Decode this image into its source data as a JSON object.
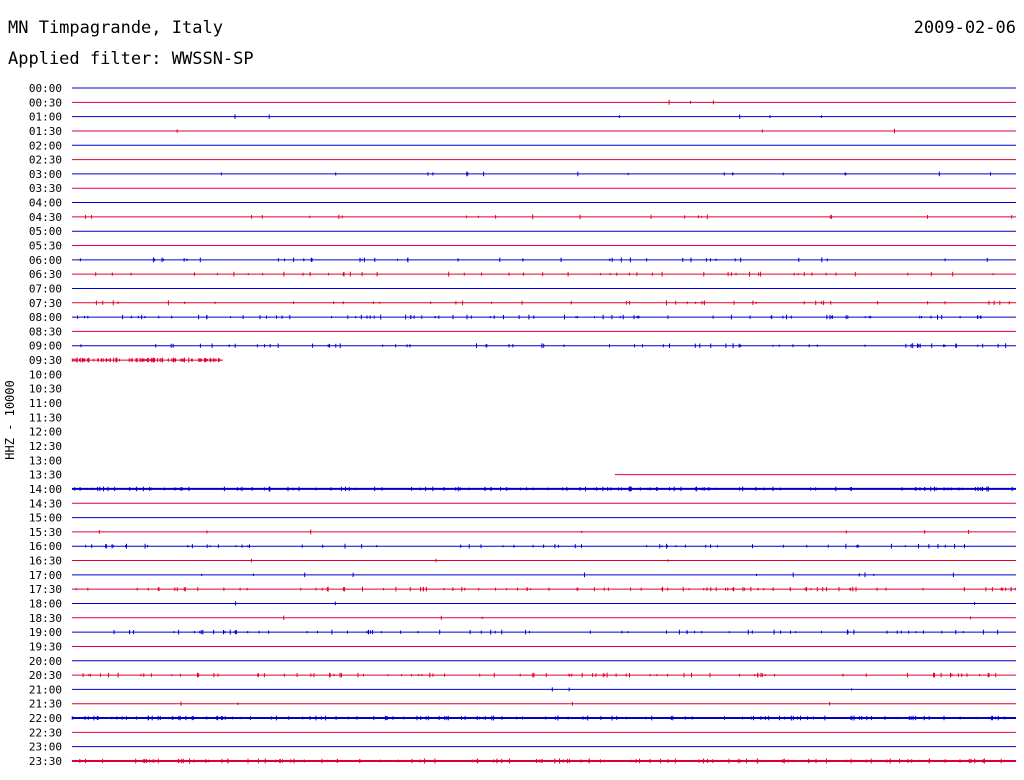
{
  "header": {
    "title": "MN Timpagrande, Italy",
    "date": "2009-02-06",
    "filter": "Applied filter: WWSSN-SP"
  },
  "colors": {
    "blue": "#0000cc",
    "red": "#dd0033",
    "background": "#ffffff",
    "text": "#000000"
  },
  "chart_data": {
    "type": "line",
    "title": "MN Timpagrande, Italy",
    "subtitle": "Applied filter: WWSSN-SP",
    "ylabel": "HHZ - 10000",
    "xlabel": "",
    "grid": false,
    "x_range_minutes": [
      0,
      30
    ],
    "series_colors": [
      "#0000cc",
      "#dd0033"
    ],
    "rows": [
      {
        "label": "00:00",
        "coverage": [
          0,
          1
        ],
        "activity": 0.0
      },
      {
        "label": "00:30",
        "coverage": [
          0,
          1
        ],
        "activity": 0.02
      },
      {
        "label": "01:00",
        "coverage": [
          0,
          1
        ],
        "activity": 0.04
      },
      {
        "label": "01:30",
        "coverage": [
          0,
          1
        ],
        "activity": 0.02
      },
      {
        "label": "02:00",
        "coverage": [
          0,
          1
        ],
        "activity": 0.0
      },
      {
        "label": "02:30",
        "coverage": [
          0,
          1
        ],
        "activity": 0.0
      },
      {
        "label": "03:00",
        "coverage": [
          0,
          1
        ],
        "activity": 0.12
      },
      {
        "label": "03:30",
        "coverage": [
          0,
          1
        ],
        "activity": 0.0
      },
      {
        "label": "04:00",
        "coverage": [
          0,
          1
        ],
        "activity": 0.0
      },
      {
        "label": "04:30",
        "coverage": [
          0,
          1
        ],
        "activity": 0.15
      },
      {
        "label": "05:00",
        "coverage": [
          0,
          1
        ],
        "activity": 0.0
      },
      {
        "label": "05:30",
        "coverage": [
          0,
          1
        ],
        "activity": 0.0
      },
      {
        "label": "06:00",
        "coverage": [
          0,
          1
        ],
        "activity": 0.3
      },
      {
        "label": "06:30",
        "coverage": [
          0,
          1
        ],
        "activity": 0.35
      },
      {
        "label": "07:00",
        "coverage": [
          0,
          1
        ],
        "activity": 0.0
      },
      {
        "label": "07:30",
        "coverage": [
          0,
          1
        ],
        "activity": 0.3
      },
      {
        "label": "08:00",
        "coverage": [
          0,
          1
        ],
        "activity": 0.6
      },
      {
        "label": "08:30",
        "coverage": [
          0,
          1
        ],
        "activity": 0.0
      },
      {
        "label": "09:00",
        "coverage": [
          0,
          1
        ],
        "activity": 0.45
      },
      {
        "label": "09:30",
        "coverage": [
          0,
          0.16
        ],
        "activity": 0.7
      },
      {
        "label": "10:00",
        "coverage": null,
        "activity": 0
      },
      {
        "label": "10:30",
        "coverage": null,
        "activity": 0
      },
      {
        "label": "11:00",
        "coverage": null,
        "activity": 0
      },
      {
        "label": "11:30",
        "coverage": null,
        "activity": 0
      },
      {
        "label": "12:00",
        "coverage": null,
        "activity": 0
      },
      {
        "label": "12:30",
        "coverage": null,
        "activity": 0
      },
      {
        "label": "13:00",
        "coverage": null,
        "activity": 0
      },
      {
        "label": "13:30",
        "coverage": [
          0.575,
          1
        ],
        "activity": 0.0
      },
      {
        "label": "14:00",
        "coverage": [
          0,
          1
        ],
        "activity": 1.0
      },
      {
        "label": "14:30",
        "coverage": [
          0,
          1
        ],
        "activity": 0.0
      },
      {
        "label": "15:00",
        "coverage": [
          0,
          1
        ],
        "activity": 0.0
      },
      {
        "label": "15:30",
        "coverage": [
          0,
          1
        ],
        "activity": 0.05
      },
      {
        "label": "16:00",
        "coverage": [
          0,
          1
        ],
        "activity": 0.45
      },
      {
        "label": "16:30",
        "coverage": [
          0,
          1
        ],
        "activity": 0.02
      },
      {
        "label": "17:00",
        "coverage": [
          0,
          1
        ],
        "activity": 0.08
      },
      {
        "label": "17:30",
        "coverage": [
          0,
          1
        ],
        "activity": 0.7
      },
      {
        "label": "18:00",
        "coverage": [
          0,
          1
        ],
        "activity": 0.02
      },
      {
        "label": "18:30",
        "coverage": [
          0,
          1
        ],
        "activity": 0.03
      },
      {
        "label": "19:00",
        "coverage": [
          0,
          1
        ],
        "activity": 0.5
      },
      {
        "label": "19:30",
        "coverage": [
          0,
          1
        ],
        "activity": 0.0
      },
      {
        "label": "20:00",
        "coverage": [
          0,
          1
        ],
        "activity": 0.0
      },
      {
        "label": "20:30",
        "coverage": [
          0,
          1
        ],
        "activity": 0.6
      },
      {
        "label": "21:00",
        "coverage": [
          0,
          1
        ],
        "activity": 0.02
      },
      {
        "label": "21:30",
        "coverage": [
          0,
          1
        ],
        "activity": 0.03
      },
      {
        "label": "22:00",
        "coverage": [
          0,
          1
        ],
        "activity": 1.0
      },
      {
        "label": "22:30",
        "coverage": [
          0,
          1
        ],
        "activity": 0.0
      },
      {
        "label": "23:00",
        "coverage": [
          0,
          1
        ],
        "activity": 0.0
      },
      {
        "label": "23:30",
        "coverage": [
          0,
          1
        ],
        "activity": 1.0
      }
    ]
  }
}
